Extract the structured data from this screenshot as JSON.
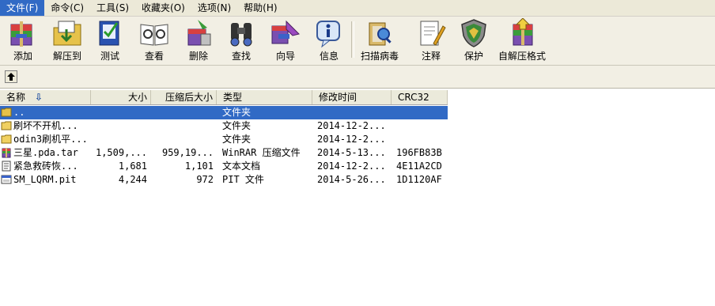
{
  "menu": [
    {
      "label": "文件(F)",
      "active": true
    },
    {
      "label": "命令(C)"
    },
    {
      "label": "工具(S)"
    },
    {
      "label": "收藏夹(O)"
    },
    {
      "label": "选项(N)"
    },
    {
      "label": "帮助(H)"
    }
  ],
  "toolbar": {
    "add": "添加",
    "extract_to": "解压到",
    "test": "测试",
    "view": "查看",
    "delete": "删除",
    "find": "查找",
    "wizard": "向导",
    "info": "信息",
    "scan_virus": "扫描病毒",
    "comment": "注释",
    "protect": "保护",
    "sfx": "自解压格式"
  },
  "columns": {
    "name": "名称",
    "size": "大小",
    "packed": "压缩后大小",
    "type": "类型",
    "modified": "修改时间",
    "crc": "CRC32"
  },
  "files": [
    {
      "name": "..",
      "size": "",
      "packed": "",
      "type": "文件夹",
      "modified": "",
      "crc": "",
      "icon": "folder-up-icon",
      "selected": true
    },
    {
      "name": "刷坏不开机...",
      "size": "",
      "packed": "",
      "type": "文件夹",
      "modified": "2014-12-2...",
      "crc": "",
      "icon": "folder-icon"
    },
    {
      "name": "odin3刷机平...",
      "size": "",
      "packed": "",
      "type": "文件夹",
      "modified": "2014-12-2...",
      "crc": "",
      "icon": "folder-icon"
    },
    {
      "name": "三星.pda.tar",
      "size": "1,509,...",
      "packed": "959,19...",
      "type": "WinRAR 压缩文件",
      "modified": "2014-5-13...",
      "crc": "196FB83B",
      "icon": "winrar-archive-icon"
    },
    {
      "name": "紧急救砖恢...",
      "size": "1,681",
      "packed": "1,101",
      "type": "文本文档",
      "modified": "2014-12-2...",
      "crc": "4E11A2CD",
      "icon": "text-document-icon"
    },
    {
      "name": "SM_LQRM.pit",
      "size": "4,244",
      "packed": "972",
      "type": "PIT 文件",
      "modified": "2014-5-26...",
      "crc": "1D1120AF",
      "icon": "pit-file-icon"
    }
  ]
}
